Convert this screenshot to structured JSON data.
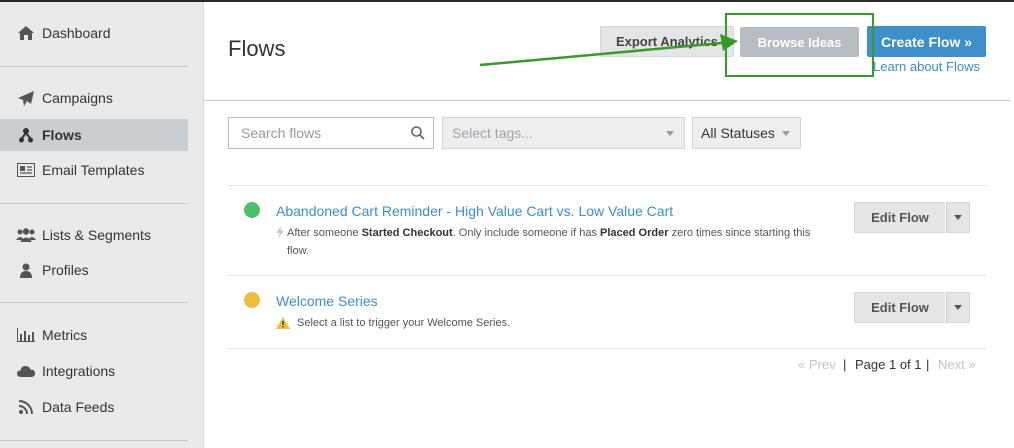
{
  "sidebar": {
    "items": [
      {
        "label": "Dashboard",
        "icon": "home-icon"
      },
      {
        "label": "Campaigns",
        "icon": "paper-plane-icon"
      },
      {
        "label": "Flows",
        "icon": "flows-icon",
        "active": true
      },
      {
        "label": "Email Templates",
        "icon": "newspaper-icon"
      },
      {
        "label": "Lists & Segments",
        "icon": "users-icon"
      },
      {
        "label": "Profiles",
        "icon": "user-icon"
      },
      {
        "label": "Metrics",
        "icon": "bar-chart-icon"
      },
      {
        "label": "Integrations",
        "icon": "cloud-icon"
      },
      {
        "label": "Data Feeds",
        "icon": "rss-icon"
      }
    ]
  },
  "header": {
    "title": "Flows",
    "export_label": "Export Analytics",
    "browse_label": "Browse Ideas",
    "create_label": "Create Flow »",
    "learn_link": "Learn about Flows"
  },
  "filters": {
    "search_placeholder": "Search flows",
    "tags_placeholder": "Select tags...",
    "status_value": "All Statuses"
  },
  "flows": [
    {
      "name": "Abandoned Cart Reminder - High Value Cart vs. Low Value Cart",
      "status_color": "#4fc06a",
      "desc_pre": "After someone ",
      "desc_b1": "Started Checkout",
      "desc_mid": ". Only include someone if has ",
      "desc_b2": "Placed Order",
      "desc_post": " zero times since starting this flow.",
      "edit_label": "Edit Flow"
    },
    {
      "name": "Welcome Series",
      "status_color": "#f0bd3a",
      "desc": "Select a list to trigger your Welcome Series.",
      "edit_label": "Edit Flow"
    }
  ],
  "pagination": {
    "prev": "« Prev",
    "separator": "|",
    "page": "Page 1 of 1",
    "next": "Next »"
  },
  "colors": {
    "accent": "#3d8ec9",
    "highlight": "#3a9a28",
    "sidebar_bg": "#e8eaec"
  }
}
